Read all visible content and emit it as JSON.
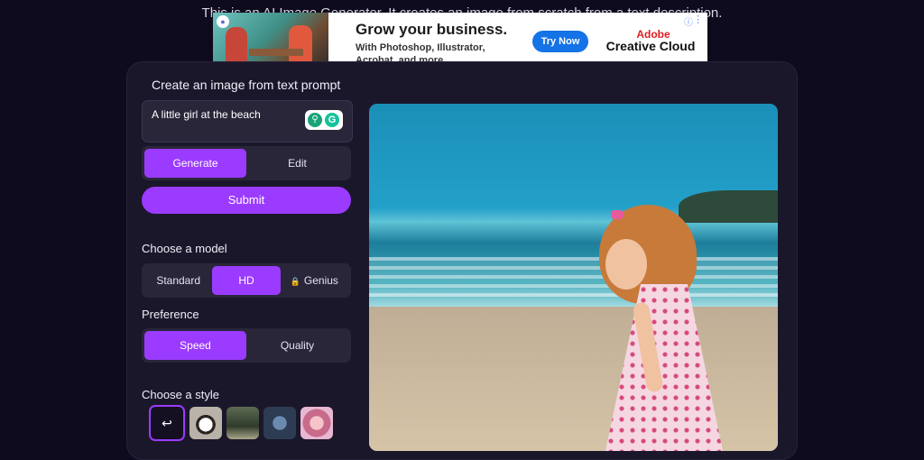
{
  "page": {
    "intro_text": "This is an AI Image Generator. It creates an image from scratch from a text description."
  },
  "ad": {
    "headline": "Grow your business.",
    "body": "With Photoshop, Illustrator, Acrobat, and more.",
    "cta": "Try Now",
    "brand_line1": "Adobe",
    "brand_line2": "Creative Cloud",
    "info_icon": "info-icon",
    "menu_icon": "kebab-menu-icon"
  },
  "panel": {
    "heading": "Create an image from text prompt",
    "prompt_value": "A little girl at the beach",
    "mode_tabs": [
      "Generate",
      "Edit"
    ],
    "mode_active": "Generate",
    "submit_label": "Submit",
    "model_label": "Choose a model",
    "models": [
      "Standard",
      "HD",
      "Genius"
    ],
    "model_active": "HD",
    "model_locked": "Genius",
    "preference_label": "Preference",
    "preferences": [
      "Speed",
      "Quality"
    ],
    "preference_active": "Speed",
    "style_label": "Choose a style",
    "styles": [
      "none",
      "panda",
      "forest",
      "robot",
      "anime-girl"
    ],
    "style_active": "none"
  },
  "colors": {
    "accent": "#9b3bff",
    "background": "#0f0b1e",
    "card": "#1b172b",
    "control": "#2a263a"
  }
}
